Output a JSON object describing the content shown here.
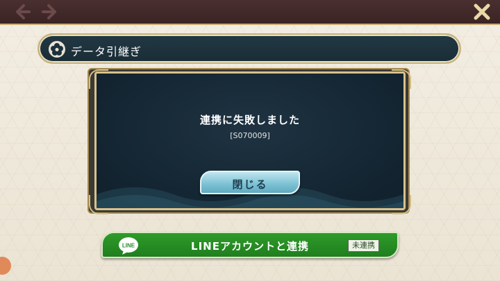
{
  "header": {
    "back_icon": "arrow-left-icon",
    "forward_icon": "arrow-right-icon",
    "close_icon": "close-x-icon",
    "accent_color": "#c9ad72"
  },
  "section": {
    "icon": "flower-icon",
    "title": "データ引継ぎ"
  },
  "dialog": {
    "message": "連携に失敗しました",
    "code": "[S070009]",
    "close_button_label": "閉じる"
  },
  "line_button": {
    "icon": "line-logo-icon",
    "icon_text": "LINE",
    "label": "LINEアカウントと連携",
    "status": "未連携",
    "color": "#2f9a2a"
  }
}
